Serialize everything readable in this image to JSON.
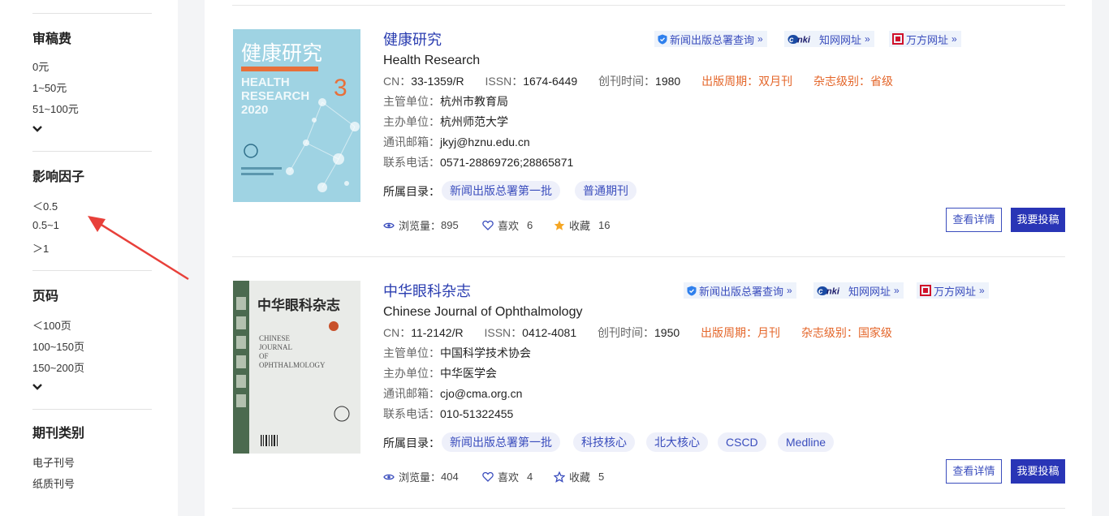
{
  "sidebar": {
    "groups": [
      {
        "title": "审稿费",
        "items": [
          "0元",
          "1~50元",
          "51~100元"
        ],
        "has_more": true
      },
      {
        "title": "影响因子",
        "items": [
          "＜0.5",
          "0.5~1",
          "＞1"
        ],
        "has_more": false
      },
      {
        "title": "页码",
        "items": [
          "＜100页",
          "100~150页",
          "150~200页"
        ],
        "has_more": true
      },
      {
        "title": "期刊类别",
        "items": [
          "电子刊号",
          "纸质刊号"
        ],
        "has_more": false
      }
    ],
    "annotation_arrow_color": "#e8403a"
  },
  "journals": [
    {
      "title": "健康研究",
      "en_title": "Health Research",
      "links": [
        "新闻出版总署查询",
        "知网网址",
        "万方网址"
      ],
      "cn_label": "CN：",
      "cn": "33-1359/R",
      "issn_label": "ISSN：",
      "issn": "1674-6449",
      "founded_label": "创刊时间：",
      "founded": "1980",
      "period_label": "出版周期：",
      "period": "双月刊",
      "level_label": "杂志级别：",
      "level": "省级",
      "supervisor_label": "主管单位：",
      "supervisor": "杭州市教育局",
      "sponsor_label": "主办单位：",
      "sponsor": "杭州师范大学",
      "email_label": "通讯邮箱：",
      "email": "jkyj@hznu.edu.cn",
      "phone_label": "联系电话：",
      "phone": "0571-28869726;28865871",
      "catalog_label": "所属目录：",
      "tags": [
        "新闻出版总署第一批",
        "普通期刊"
      ],
      "views_label": "浏览量：",
      "views": "895",
      "likes_label": "喜欢",
      "likes": "6",
      "favs_label": "收藏",
      "favs": "16",
      "favorited": true,
      "detail_btn": "查看详情",
      "submit_btn": "我要投稿",
      "cover": {
        "title_cn": "健康研究",
        "title_en_1": "HEALTH",
        "title_en_2": "RESEARCH",
        "year": "2020",
        "issue": "3",
        "bg_color": "#9fd3e3",
        "issue_color": "#e8703a"
      }
    },
    {
      "title": "中华眼科杂志",
      "en_title": "Chinese Journal of Ophthalmology",
      "links": [
        "新闻出版总署查询",
        "知网网址",
        "万方网址"
      ],
      "cn_label": "CN：",
      "cn": "11-2142/R",
      "issn_label": "ISSN：",
      "issn": "0412-4081",
      "founded_label": "创刊时间：",
      "founded": "1950",
      "period_label": "出版周期：",
      "period": "月刊",
      "level_label": "杂志级别：",
      "level": "国家级",
      "supervisor_label": "主管单位：",
      "supervisor": "中国科学技术协会",
      "sponsor_label": "主办单位：",
      "sponsor": "中华医学会",
      "email_label": "通讯邮箱：",
      "email": "cjo@cma.org.cn",
      "phone_label": "联系电话：",
      "phone": "010-51322455",
      "catalog_label": "所属目录：",
      "tags": [
        "新闻出版总署第一批",
        "科技核心",
        "北大核心",
        "CSCD",
        "Medline"
      ],
      "views_label": "浏览量：",
      "views": "404",
      "likes_label": "喜欢",
      "likes": "4",
      "favs_label": "收藏",
      "favs": "5",
      "favorited": false,
      "detail_btn": "查看详情",
      "submit_btn": "我要投稿",
      "cover": {
        "title_cn": "中华眼科杂志",
        "title_en_1": "CHINESE",
        "title_en_2": "JOURNAL",
        "title_en_3": "OF",
        "title_en_4": "OPHTHALMOLOGY",
        "bg_color": "#e9ebe8",
        "spine_color": "#4b6a4f"
      }
    }
  ],
  "colors": {
    "accent": "#2935b6",
    "link": "#3a4dbd",
    "orange": "#e4662a",
    "star_active": "#f5a623"
  }
}
